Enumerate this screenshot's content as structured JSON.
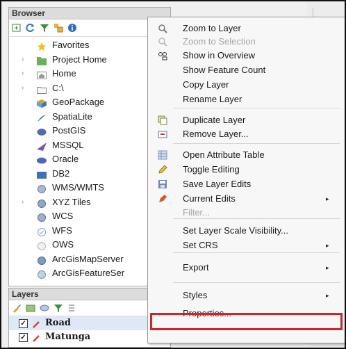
{
  "browser": {
    "title": "Browser",
    "tree": [
      {
        "label": "Favorites",
        "icon": "star-icon",
        "expander": false
      },
      {
        "label": "Project Home",
        "icon": "project-folder-icon",
        "expander": true
      },
      {
        "label": "Home",
        "icon": "home-folder-icon",
        "expander": true
      },
      {
        "label": "C:\\",
        "icon": "folder-icon",
        "expander": true
      },
      {
        "label": "GeoPackage",
        "icon": "geopackage-icon",
        "expander": false
      },
      {
        "label": "SpatiaLite",
        "icon": "spatialite-icon",
        "expander": false
      },
      {
        "label": "PostGIS",
        "icon": "postgis-icon",
        "expander": false
      },
      {
        "label": "MSSQL",
        "icon": "mssql-icon",
        "expander": false
      },
      {
        "label": "Oracle",
        "icon": "oracle-icon",
        "expander": false
      },
      {
        "label": "DB2",
        "icon": "db2-icon",
        "expander": false
      },
      {
        "label": "WMS/WMTS",
        "icon": "wms-icon",
        "expander": false
      },
      {
        "label": "XYZ Tiles",
        "icon": "xyz-tiles-icon",
        "expander": true
      },
      {
        "label": "WCS",
        "icon": "wcs-icon",
        "expander": false
      },
      {
        "label": "WFS",
        "icon": "wfs-icon",
        "expander": false
      },
      {
        "label": "OWS",
        "icon": "ows-icon",
        "expander": false
      },
      {
        "label": "ArcGisMapServer",
        "icon": "arcgis-map-icon",
        "expander": false
      },
      {
        "label": "ArcGisFeatureSer",
        "icon": "arcgis-feature-icon",
        "expander": false
      }
    ]
  },
  "layers": {
    "title": "Layers",
    "items": [
      {
        "label": "Road",
        "checked": true
      },
      {
        "label": "Matunga",
        "checked": true
      }
    ]
  },
  "menu": {
    "items": [
      {
        "label": "Zoom to Layer",
        "icon": "zoom-layer-icon",
        "disabled": false,
        "submenu": false
      },
      {
        "label": "Zoom to Selection",
        "icon": "zoom-selection-icon",
        "disabled": true,
        "submenu": false
      },
      {
        "label": "Show in Overview",
        "icon": "overview-icon",
        "disabled": false,
        "submenu": false
      },
      {
        "label": "Show Feature Count",
        "icon": "",
        "disabled": false,
        "submenu": false
      },
      {
        "label": "Copy Layer",
        "icon": "",
        "disabled": false,
        "submenu": false
      },
      {
        "label": "Rename Layer",
        "icon": "",
        "disabled": false,
        "submenu": false
      },
      {
        "label": "Duplicate Layer",
        "icon": "duplicate-icon",
        "disabled": false,
        "submenu": false
      },
      {
        "label": "Remove Layer...",
        "icon": "remove-icon",
        "disabled": false,
        "submenu": false
      },
      {
        "label": "Open Attribute Table",
        "icon": "table-icon",
        "disabled": false,
        "submenu": false
      },
      {
        "label": "Toggle Editing",
        "icon": "pencil-icon",
        "disabled": false,
        "submenu": false
      },
      {
        "label": "Save Layer Edits",
        "icon": "save-icon",
        "disabled": false,
        "submenu": false
      },
      {
        "label": "Current Edits",
        "icon": "edits-icon",
        "disabled": false,
        "submenu": true
      },
      {
        "label": "Filter...",
        "icon": "",
        "disabled": true,
        "submenu": false
      },
      {
        "label": "Set Layer Scale Visibility...",
        "icon": "",
        "disabled": false,
        "submenu": false
      },
      {
        "label": "Set CRS",
        "icon": "",
        "disabled": false,
        "submenu": true
      },
      {
        "label": "Export",
        "icon": "",
        "disabled": false,
        "submenu": true
      },
      {
        "label": "Styles",
        "icon": "",
        "disabled": false,
        "submenu": true
      },
      {
        "label": "Properties...",
        "icon": "",
        "disabled": false,
        "submenu": false,
        "highlighted": true
      }
    ]
  },
  "colors": {
    "highlight_border": "#d3222a"
  }
}
